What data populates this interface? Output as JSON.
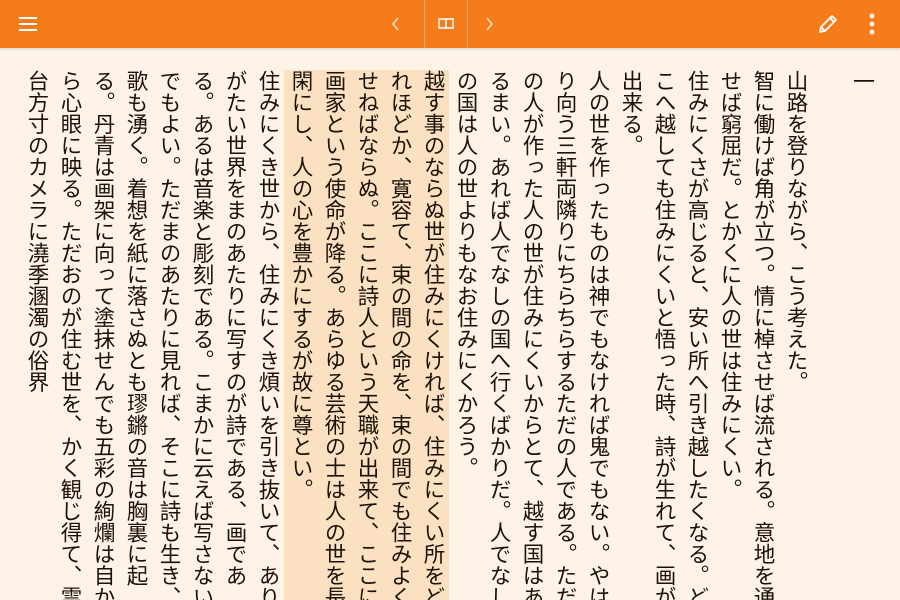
{
  "toolbar": {
    "menu_icon": "hamburger-menu-icon",
    "prev_icon": "chevron-left-icon",
    "book_icon": "open-book-icon",
    "next_icon": "chevron-right-icon",
    "edit_icon": "pencil-icon",
    "more_icon": "more-vert-icon",
    "bg_color": "#f47c1b"
  },
  "book": {
    "chapter": "一",
    "paragraphs": [
      "山路を登りながら、こう考えた。",
      "智に働けば角が立つ。情に棹させば流される。意地を通せば窮屈だ。とかくに人の世は住みにくい。",
      "住みにくさが高じると、安い所へ引き越したくなる。どこへ越しても住みにくいと悟った時、詩が生れて、画が出来る。",
      "人の世を作ったものは神でもなければ鬼でもない。やはり向う三軒両隣りにちらちらするただの人である。ただの人が作った人の世が住みにくいからとて、越す国はあるまい。あれば人でなしの国へ行くばかりだ。人でなしの国は人の世よりもなお住みにくかろう。",
      "越す事のならぬ世が住みにくければ、住みにくい所をどれほどか、寛容て、束の間の命を、束の間でも住みよくせねばならぬ。ここに詩人という天職が出来て、ここに画家という使命が降る。あらゆる芸術の士は人の世を長閑にし、人の心を豊かにするが故に尊とい。",
      "住みにくき世から、住みにくき煩いを引き抜いて、ありがたい世界をまのあたりに写すのが詩である、画である。あるは音楽と彫刻である。こまかに云えば写さないでもよい。ただまのあたりに見れば、そこに詩も生き、歌も湧く。着想を紙に落さぬとも璆鏘の音は胸裏に起る。丹青は画架に向って塗抹せんでも五彩の絢爛は自から心眼に映る。ただおのが住む世を、かく観じ得て、霊台方寸のカメラに澆季溷濁の俗界"
    ],
    "highlight_color": "#fbe0c2",
    "link_color": "#2b2bff"
  }
}
